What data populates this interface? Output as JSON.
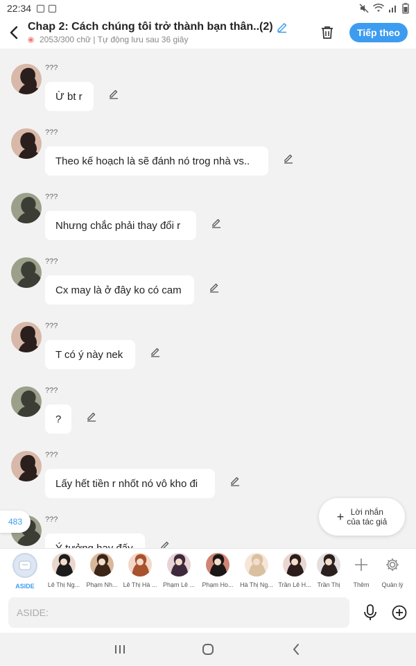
{
  "status_bar": {
    "time": "22:34"
  },
  "header": {
    "title": "Chap 2: Cách chúng tôi trở thành bạn thân..(2)",
    "subtitle": "2053/300 chữ | Tự động lưu sau 36 giây",
    "next_label": "Tiếp theo"
  },
  "messages": [
    {
      "name": "???",
      "text": "Ừ bt r",
      "avatar": "dark"
    },
    {
      "name": "???",
      "text": "Theo kế hoạch là sẽ đánh nó trog nhà vs..",
      "avatar": "dark"
    },
    {
      "name": "???",
      "text": "Nhưng chắc phải thay đổi r",
      "avatar": "green"
    },
    {
      "name": "???",
      "text": "Cx may là ở đây ko có cam",
      "avatar": "green"
    },
    {
      "name": "???",
      "text": "T có ý này nek",
      "avatar": "dark"
    },
    {
      "name": "???",
      "text": "?",
      "avatar": "green"
    },
    {
      "name": "???",
      "text": "Lấy hết tiền r nhốt nó vô kho đi",
      "avatar": "dark"
    },
    {
      "name": "???",
      "text": "Ý tưởng hay đấy",
      "avatar": "green"
    }
  ],
  "side_badge": "483",
  "author_note": {
    "line1": "Lời nhắn",
    "line2": "của tác giả"
  },
  "characters": [
    {
      "label": "ASIDE"
    },
    {
      "label": "Lê Thị Ng..."
    },
    {
      "label": "Phạm Nh..."
    },
    {
      "label": "Lê Thị Hà ..."
    },
    {
      "label": "Phạm Lê ..."
    },
    {
      "label": "Phạm Ho..."
    },
    {
      "label": "Hà Thị Ng..."
    },
    {
      "label": "Trần Lê H..."
    },
    {
      "label": "Trần Thị"
    },
    {
      "label": "Thêm"
    },
    {
      "label": "Quản lý"
    }
  ],
  "input": {
    "placeholder": "ASIDE:"
  },
  "colors": {
    "accent": "#3d9cf0",
    "background": "#f2f2f2"
  }
}
